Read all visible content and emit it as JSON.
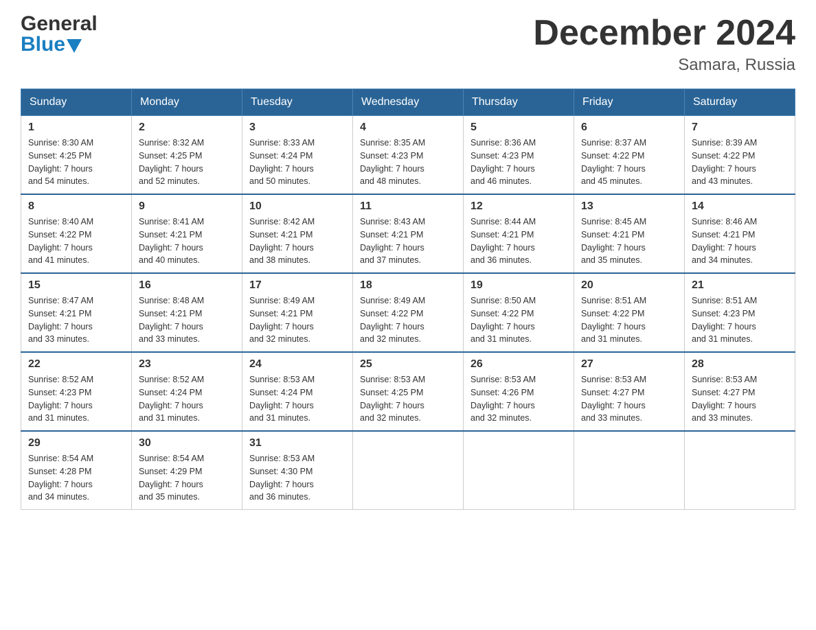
{
  "header": {
    "logo": {
      "general": "General",
      "blue": "Blue",
      "arrow_color": "#1a7fc1"
    },
    "title": "December 2024",
    "subtitle": "Samara, Russia"
  },
  "calendar": {
    "days_of_week": [
      "Sunday",
      "Monday",
      "Tuesday",
      "Wednesday",
      "Thursday",
      "Friday",
      "Saturday"
    ],
    "weeks": [
      [
        {
          "day": "1",
          "sunrise": "8:30 AM",
          "sunset": "4:25 PM",
          "daylight": "7 hours and 54 minutes."
        },
        {
          "day": "2",
          "sunrise": "8:32 AM",
          "sunset": "4:25 PM",
          "daylight": "7 hours and 52 minutes."
        },
        {
          "day": "3",
          "sunrise": "8:33 AM",
          "sunset": "4:24 PM",
          "daylight": "7 hours and 50 minutes."
        },
        {
          "day": "4",
          "sunrise": "8:35 AM",
          "sunset": "4:23 PM",
          "daylight": "7 hours and 48 minutes."
        },
        {
          "day": "5",
          "sunrise": "8:36 AM",
          "sunset": "4:23 PM",
          "daylight": "7 hours and 46 minutes."
        },
        {
          "day": "6",
          "sunrise": "8:37 AM",
          "sunset": "4:22 PM",
          "daylight": "7 hours and 45 minutes."
        },
        {
          "day": "7",
          "sunrise": "8:39 AM",
          "sunset": "4:22 PM",
          "daylight": "7 hours and 43 minutes."
        }
      ],
      [
        {
          "day": "8",
          "sunrise": "8:40 AM",
          "sunset": "4:22 PM",
          "daylight": "7 hours and 41 minutes."
        },
        {
          "day": "9",
          "sunrise": "8:41 AM",
          "sunset": "4:21 PM",
          "daylight": "7 hours and 40 minutes."
        },
        {
          "day": "10",
          "sunrise": "8:42 AM",
          "sunset": "4:21 PM",
          "daylight": "7 hours and 38 minutes."
        },
        {
          "day": "11",
          "sunrise": "8:43 AM",
          "sunset": "4:21 PM",
          "daylight": "7 hours and 37 minutes."
        },
        {
          "day": "12",
          "sunrise": "8:44 AM",
          "sunset": "4:21 PM",
          "daylight": "7 hours and 36 minutes."
        },
        {
          "day": "13",
          "sunrise": "8:45 AM",
          "sunset": "4:21 PM",
          "daylight": "7 hours and 35 minutes."
        },
        {
          "day": "14",
          "sunrise": "8:46 AM",
          "sunset": "4:21 PM",
          "daylight": "7 hours and 34 minutes."
        }
      ],
      [
        {
          "day": "15",
          "sunrise": "8:47 AM",
          "sunset": "4:21 PM",
          "daylight": "7 hours and 33 minutes."
        },
        {
          "day": "16",
          "sunrise": "8:48 AM",
          "sunset": "4:21 PM",
          "daylight": "7 hours and 33 minutes."
        },
        {
          "day": "17",
          "sunrise": "8:49 AM",
          "sunset": "4:21 PM",
          "daylight": "7 hours and 32 minutes."
        },
        {
          "day": "18",
          "sunrise": "8:49 AM",
          "sunset": "4:22 PM",
          "daylight": "7 hours and 32 minutes."
        },
        {
          "day": "19",
          "sunrise": "8:50 AM",
          "sunset": "4:22 PM",
          "daylight": "7 hours and 31 minutes."
        },
        {
          "day": "20",
          "sunrise": "8:51 AM",
          "sunset": "4:22 PM",
          "daylight": "7 hours and 31 minutes."
        },
        {
          "day": "21",
          "sunrise": "8:51 AM",
          "sunset": "4:23 PM",
          "daylight": "7 hours and 31 minutes."
        }
      ],
      [
        {
          "day": "22",
          "sunrise": "8:52 AM",
          "sunset": "4:23 PM",
          "daylight": "7 hours and 31 minutes."
        },
        {
          "day": "23",
          "sunrise": "8:52 AM",
          "sunset": "4:24 PM",
          "daylight": "7 hours and 31 minutes."
        },
        {
          "day": "24",
          "sunrise": "8:53 AM",
          "sunset": "4:24 PM",
          "daylight": "7 hours and 31 minutes."
        },
        {
          "day": "25",
          "sunrise": "8:53 AM",
          "sunset": "4:25 PM",
          "daylight": "7 hours and 32 minutes."
        },
        {
          "day": "26",
          "sunrise": "8:53 AM",
          "sunset": "4:26 PM",
          "daylight": "7 hours and 32 minutes."
        },
        {
          "day": "27",
          "sunrise": "8:53 AM",
          "sunset": "4:27 PM",
          "daylight": "7 hours and 33 minutes."
        },
        {
          "day": "28",
          "sunrise": "8:53 AM",
          "sunset": "4:27 PM",
          "daylight": "7 hours and 33 minutes."
        }
      ],
      [
        {
          "day": "29",
          "sunrise": "8:54 AM",
          "sunset": "4:28 PM",
          "daylight": "7 hours and 34 minutes."
        },
        {
          "day": "30",
          "sunrise": "8:54 AM",
          "sunset": "4:29 PM",
          "daylight": "7 hours and 35 minutes."
        },
        {
          "day": "31",
          "sunrise": "8:53 AM",
          "sunset": "4:30 PM",
          "daylight": "7 hours and 36 minutes."
        },
        null,
        null,
        null,
        null
      ]
    ],
    "labels": {
      "sunrise": "Sunrise:",
      "sunset": "Sunset:",
      "daylight": "Daylight:"
    }
  }
}
